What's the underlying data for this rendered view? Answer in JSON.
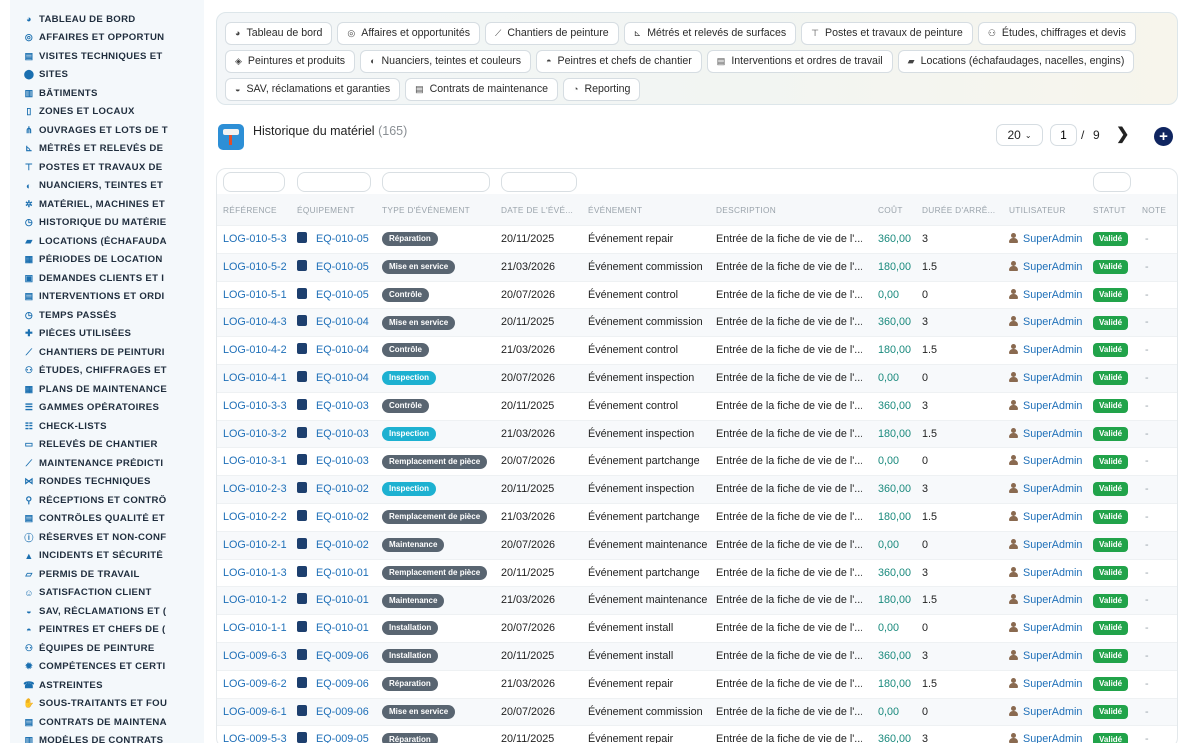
{
  "sidebar": {
    "items": [
      {
        "label": "TABLEAU DE BORD",
        "icon": "dashboard-icon",
        "glyph": "◕"
      },
      {
        "label": "AFFAIRES ET OPPORTUN",
        "icon": "target-icon",
        "glyph": "◎"
      },
      {
        "label": "VISITES TECHNIQUES ET",
        "icon": "clipboard-icon",
        "glyph": "▤"
      },
      {
        "label": "SITES",
        "icon": "map-pin-icon",
        "glyph": "⬤"
      },
      {
        "label": "BÂTIMENTS",
        "icon": "building-icon",
        "glyph": "▥"
      },
      {
        "label": "ZONES ET LOCAUX",
        "icon": "door-icon",
        "glyph": "▯"
      },
      {
        "label": "OUVRAGES ET LOTS DE T",
        "icon": "sitemap-icon",
        "glyph": "⋔"
      },
      {
        "label": "MÉTRÉS ET RELEVÉS DE",
        "icon": "ruler-icon",
        "glyph": "⊾"
      },
      {
        "label": "POSTES ET TRAVAUX DE",
        "icon": "paint-roller-icon",
        "glyph": "⊤"
      },
      {
        "label": "NUANCIERS, TEINTES ET",
        "icon": "palette-icon",
        "glyph": "◐"
      },
      {
        "label": "MATÉRIEL, MACHINES ET",
        "icon": "cogs-icon",
        "glyph": "✲"
      },
      {
        "label": "HISTORIQUE DU MATÉRIE",
        "icon": "history-icon",
        "glyph": "◷"
      },
      {
        "label": "LOCATIONS (ÉCHAFAUDA",
        "icon": "truck-icon",
        "glyph": "▰"
      },
      {
        "label": "PÉRIODES DE LOCATION",
        "icon": "calendar-icon",
        "glyph": "▦"
      },
      {
        "label": "DEMANDES CLIENTS ET I",
        "icon": "inbox-icon",
        "glyph": "▣"
      },
      {
        "label": "INTERVENTIONS ET ORDI",
        "icon": "clipboard-check-icon",
        "glyph": "▤"
      },
      {
        "label": "TEMPS PASSÉS",
        "icon": "clock-icon",
        "glyph": "◷"
      },
      {
        "label": "PIÈCES UTILISÉES",
        "icon": "puzzle-icon",
        "glyph": "✚"
      },
      {
        "label": "CHANTIERS DE PEINTURI",
        "icon": "brush-icon",
        "glyph": "⟋"
      },
      {
        "label": "ÉTUDES, CHIFFRAGES ET",
        "icon": "people-icon",
        "glyph": "⚇"
      },
      {
        "label": "PLANS DE MAINTENANCE",
        "icon": "calendar-check-icon",
        "glyph": "▦"
      },
      {
        "label": "GAMMES OPÉRATOIRES",
        "icon": "list-icon",
        "glyph": "☰"
      },
      {
        "label": "CHECK-LISTS",
        "icon": "checklist-icon",
        "glyph": "☷"
      },
      {
        "label": "RELEVÉS DE CHANTIER",
        "icon": "file-icon",
        "glyph": "▭"
      },
      {
        "label": "MAINTENANCE PRÉDICTI",
        "icon": "chart-line-icon",
        "glyph": "⟋"
      },
      {
        "label": "RONDES TECHNIQUES",
        "icon": "route-icon",
        "glyph": "⋈"
      },
      {
        "label": "RÉCEPTIONS ET CONTRÔ",
        "icon": "search-icon",
        "glyph": "⚲"
      },
      {
        "label": "CONTRÔLES QUALITÉ ET",
        "icon": "clipboard-list-icon",
        "glyph": "▤"
      },
      {
        "label": "RÉSERVES ET NON-CONF",
        "icon": "info-icon",
        "glyph": "ⓘ"
      },
      {
        "label": "INCIDENTS ET SÉCURITÉ",
        "icon": "warning-icon",
        "glyph": "▲"
      },
      {
        "label": "PERMIS DE TRAVAIL",
        "icon": "permit-icon",
        "glyph": "▱"
      },
      {
        "label": "SATISFACTION CLIENT",
        "icon": "smile-icon",
        "glyph": "☺"
      },
      {
        "label": "SAV, RÉCLAMATIONS ET (",
        "icon": "comment-icon",
        "glyph": "◒"
      },
      {
        "label": "PEINTRES ET CHEFS DE (",
        "icon": "hard-hat-icon",
        "glyph": "◓"
      },
      {
        "label": "ÉQUIPES DE PEINTURE",
        "icon": "team-icon",
        "glyph": "⚇"
      },
      {
        "label": "COMPÉTENCES ET CERTI",
        "icon": "certificate-icon",
        "glyph": "✹"
      },
      {
        "label": "ASTREINTES",
        "icon": "phone-icon",
        "glyph": "☎"
      },
      {
        "label": "SOUS-TRAITANTS ET FOU",
        "icon": "handshake-icon",
        "glyph": "✋"
      },
      {
        "label": "CONTRATS DE MAINTENA",
        "icon": "contract-icon",
        "glyph": "▤"
      },
      {
        "label": "MODÈLES DE CONTRATS",
        "icon": "template-icon",
        "glyph": "▥"
      }
    ]
  },
  "nav": {
    "row1": [
      {
        "label": "Tableau de bord",
        "icon": "dashboard-icon",
        "glyph": "◕"
      },
      {
        "label": "Affaires et opportunités",
        "icon": "target-icon",
        "glyph": "◎"
      },
      {
        "label": "Chantiers de peinture",
        "icon": "brush-icon",
        "glyph": "⟋"
      },
      {
        "label": "Métrés et relevés de surfaces",
        "icon": "ruler-icon",
        "glyph": "⊾"
      },
      {
        "label": "Postes et travaux de peinture",
        "icon": "paint-roller-icon",
        "glyph": "⊤"
      },
      {
        "label": "Études, chiffrages et devis",
        "icon": "people-icon",
        "glyph": "⚇"
      }
    ],
    "row2": [
      {
        "label": "Peintures et produits",
        "icon": "fill-drip-icon",
        "glyph": "◈"
      },
      {
        "label": "Nuanciers, teintes et couleurs",
        "icon": "palette-icon",
        "glyph": "◐"
      },
      {
        "label": "Peintres et chefs de chantier",
        "icon": "hard-hat-icon",
        "glyph": "◓"
      },
      {
        "label": "Interventions et ordres de travail",
        "icon": "clipboard-check-icon",
        "glyph": "▤"
      },
      {
        "label": "Locations (échafaudages, nacelles, engins)",
        "icon": "truck-icon",
        "glyph": "▰"
      }
    ],
    "row3": [
      {
        "label": "SAV, réclamations et garanties",
        "icon": "comment-icon",
        "glyph": "◒"
      },
      {
        "label": "Contrats de maintenance",
        "icon": "contract-icon",
        "glyph": "▤"
      },
      {
        "label": "Reporting",
        "icon": "chart-pie-icon",
        "glyph": "◔"
      }
    ]
  },
  "page": {
    "title": "Historique du matériel",
    "count": "(165)"
  },
  "pagination": {
    "per_page": "20",
    "current": "1",
    "separator": "/",
    "total": "9",
    "next_glyph": "❯",
    "add_glyph": "+"
  },
  "table": {
    "headers": {
      "reference": "RÉFÉRENCE",
      "equipement": "ÉQUIPEMENT",
      "type": "TYPE D'ÉVÉNEMENT",
      "date": "DATE DE L'ÉVÉ...",
      "evenement": "ÉVÉNEMENT",
      "description": "DESCRIPTION",
      "cout": "COÛT",
      "duree": "DURÉE D'ARRÊ...",
      "utilisateur": "UTILISATEUR",
      "statut": "STATUT",
      "note": "NOTE"
    },
    "badge_colors": {
      "Réparation": "#596571",
      "Mise en service": "#596571",
      "Contrôle": "#596571",
      "Inspection": "#1db1d1",
      "Remplacement de pièce": "#596571",
      "Maintenance": "#596571",
      "Installation": "#596571"
    },
    "rows": [
      {
        "ref": "LOG-010-5-3",
        "eq": "EQ-010-05",
        "type": "Réparation",
        "date": "20/11/2025",
        "event": "Événement repair",
        "desc": "Entrée de la fiche de vie de l'...",
        "cost": "360,00",
        "duree": "3",
        "user": "SuperAdmin",
        "status": "Validé",
        "note": "-"
      },
      {
        "ref": "LOG-010-5-2",
        "eq": "EQ-010-05",
        "type": "Mise en service",
        "date": "21/03/2026",
        "event": "Événement commission",
        "desc": "Entrée de la fiche de vie de l'...",
        "cost": "180,00",
        "duree": "1.5",
        "user": "SuperAdmin",
        "status": "Validé",
        "note": "-"
      },
      {
        "ref": "LOG-010-5-1",
        "eq": "EQ-010-05",
        "type": "Contrôle",
        "date": "20/07/2026",
        "event": "Événement control",
        "desc": "Entrée de la fiche de vie de l'...",
        "cost": "0,00",
        "duree": "0",
        "user": "SuperAdmin",
        "status": "Validé",
        "note": "-"
      },
      {
        "ref": "LOG-010-4-3",
        "eq": "EQ-010-04",
        "type": "Mise en service",
        "date": "20/11/2025",
        "event": "Événement commission",
        "desc": "Entrée de la fiche de vie de l'...",
        "cost": "360,00",
        "duree": "3",
        "user": "SuperAdmin",
        "status": "Validé",
        "note": "-"
      },
      {
        "ref": "LOG-010-4-2",
        "eq": "EQ-010-04",
        "type": "Contrôle",
        "date": "21/03/2026",
        "event": "Événement control",
        "desc": "Entrée de la fiche de vie de l'...",
        "cost": "180,00",
        "duree": "1.5",
        "user": "SuperAdmin",
        "status": "Validé",
        "note": "-"
      },
      {
        "ref": "LOG-010-4-1",
        "eq": "EQ-010-04",
        "type": "Inspection",
        "date": "20/07/2026",
        "event": "Événement inspection",
        "desc": "Entrée de la fiche de vie de l'...",
        "cost": "0,00",
        "duree": "0",
        "user": "SuperAdmin",
        "status": "Validé",
        "note": "-"
      },
      {
        "ref": "LOG-010-3-3",
        "eq": "EQ-010-03",
        "type": "Contrôle",
        "date": "20/11/2025",
        "event": "Événement control",
        "desc": "Entrée de la fiche de vie de l'...",
        "cost": "360,00",
        "duree": "3",
        "user": "SuperAdmin",
        "status": "Validé",
        "note": "-"
      },
      {
        "ref": "LOG-010-3-2",
        "eq": "EQ-010-03",
        "type": "Inspection",
        "date": "21/03/2026",
        "event": "Événement inspection",
        "desc": "Entrée de la fiche de vie de l'...",
        "cost": "180,00",
        "duree": "1.5",
        "user": "SuperAdmin",
        "status": "Validé",
        "note": "-"
      },
      {
        "ref": "LOG-010-3-1",
        "eq": "EQ-010-03",
        "type": "Remplacement de pièce",
        "date": "20/07/2026",
        "event": "Événement partchange",
        "desc": "Entrée de la fiche de vie de l'...",
        "cost": "0,00",
        "duree": "0",
        "user": "SuperAdmin",
        "status": "Validé",
        "note": "-"
      },
      {
        "ref": "LOG-010-2-3",
        "eq": "EQ-010-02",
        "type": "Inspection",
        "date": "20/11/2025",
        "event": "Événement inspection",
        "desc": "Entrée de la fiche de vie de l'...",
        "cost": "360,00",
        "duree": "3",
        "user": "SuperAdmin",
        "status": "Validé",
        "note": "-"
      },
      {
        "ref": "LOG-010-2-2",
        "eq": "EQ-010-02",
        "type": "Remplacement de pièce",
        "date": "21/03/2026",
        "event": "Événement partchange",
        "desc": "Entrée de la fiche de vie de l'...",
        "cost": "180,00",
        "duree": "1.5",
        "user": "SuperAdmin",
        "status": "Validé",
        "note": "-"
      },
      {
        "ref": "LOG-010-2-1",
        "eq": "EQ-010-02",
        "type": "Maintenance",
        "date": "20/07/2026",
        "event": "Événement maintenance",
        "desc": "Entrée de la fiche de vie de l'...",
        "cost": "0,00",
        "duree": "0",
        "user": "SuperAdmin",
        "status": "Validé",
        "note": "-"
      },
      {
        "ref": "LOG-010-1-3",
        "eq": "EQ-010-01",
        "type": "Remplacement de pièce",
        "date": "20/11/2025",
        "event": "Événement partchange",
        "desc": "Entrée de la fiche de vie de l'...",
        "cost": "360,00",
        "duree": "3",
        "user": "SuperAdmin",
        "status": "Validé",
        "note": "-"
      },
      {
        "ref": "LOG-010-1-2",
        "eq": "EQ-010-01",
        "type": "Maintenance",
        "date": "21/03/2026",
        "event": "Événement maintenance",
        "desc": "Entrée de la fiche de vie de l'...",
        "cost": "180,00",
        "duree": "1.5",
        "user": "SuperAdmin",
        "status": "Validé",
        "note": "-"
      },
      {
        "ref": "LOG-010-1-1",
        "eq": "EQ-010-01",
        "type": "Installation",
        "date": "20/07/2026",
        "event": "Événement install",
        "desc": "Entrée de la fiche de vie de l'...",
        "cost": "0,00",
        "duree": "0",
        "user": "SuperAdmin",
        "status": "Validé",
        "note": "-"
      },
      {
        "ref": "LOG-009-6-3",
        "eq": "EQ-009-06",
        "type": "Installation",
        "date": "20/11/2025",
        "event": "Événement install",
        "desc": "Entrée de la fiche de vie de l'...",
        "cost": "360,00",
        "duree": "3",
        "user": "SuperAdmin",
        "status": "Validé",
        "note": "-"
      },
      {
        "ref": "LOG-009-6-2",
        "eq": "EQ-009-06",
        "type": "Réparation",
        "date": "21/03/2026",
        "event": "Événement repair",
        "desc": "Entrée de la fiche de vie de l'...",
        "cost": "180,00",
        "duree": "1.5",
        "user": "SuperAdmin",
        "status": "Validé",
        "note": "-"
      },
      {
        "ref": "LOG-009-6-1",
        "eq": "EQ-009-06",
        "type": "Mise en service",
        "date": "20/07/2026",
        "event": "Événement commission",
        "desc": "Entrée de la fiche de vie de l'...",
        "cost": "0,00",
        "duree": "0",
        "user": "SuperAdmin",
        "status": "Validé",
        "note": "-"
      },
      {
        "ref": "LOG-009-5-3",
        "eq": "EQ-009-05",
        "type": "Réparation",
        "date": "20/11/2025",
        "event": "Événement repair",
        "desc": "Entrée de la fiche de vie de l'...",
        "cost": "360,00",
        "duree": "3",
        "user": "SuperAdmin",
        "status": "Validé",
        "note": "-"
      }
    ]
  }
}
